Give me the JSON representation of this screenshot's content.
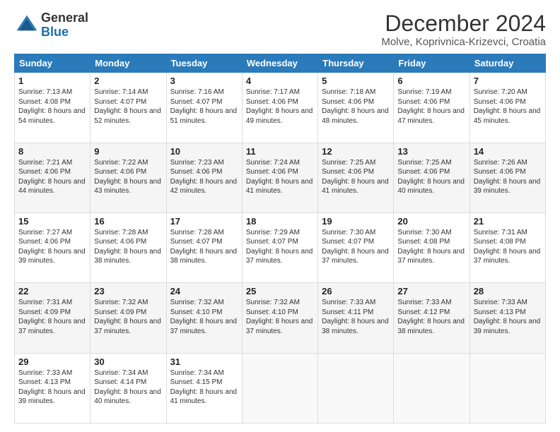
{
  "logo": {
    "general": "General",
    "blue": "Blue"
  },
  "header": {
    "title": "December 2024",
    "subtitle": "Molve, Koprivnica-Krizevci, Croatia"
  },
  "weekdays": [
    "Sunday",
    "Monday",
    "Tuesday",
    "Wednesday",
    "Thursday",
    "Friday",
    "Saturday"
  ],
  "weeks": [
    [
      {
        "day": "1",
        "sunrise": "Sunrise: 7:13 AM",
        "sunset": "Sunset: 4:08 PM",
        "daylight": "Daylight: 8 hours and 54 minutes."
      },
      {
        "day": "2",
        "sunrise": "Sunrise: 7:14 AM",
        "sunset": "Sunset: 4:07 PM",
        "daylight": "Daylight: 8 hours and 52 minutes."
      },
      {
        "day": "3",
        "sunrise": "Sunrise: 7:16 AM",
        "sunset": "Sunset: 4:07 PM",
        "daylight": "Daylight: 8 hours and 51 minutes."
      },
      {
        "day": "4",
        "sunrise": "Sunrise: 7:17 AM",
        "sunset": "Sunset: 4:06 PM",
        "daylight": "Daylight: 8 hours and 49 minutes."
      },
      {
        "day": "5",
        "sunrise": "Sunrise: 7:18 AM",
        "sunset": "Sunset: 4:06 PM",
        "daylight": "Daylight: 8 hours and 48 minutes."
      },
      {
        "day": "6",
        "sunrise": "Sunrise: 7:19 AM",
        "sunset": "Sunset: 4:06 PM",
        "daylight": "Daylight: 8 hours and 47 minutes."
      },
      {
        "day": "7",
        "sunrise": "Sunrise: 7:20 AM",
        "sunset": "Sunset: 4:06 PM",
        "daylight": "Daylight: 8 hours and 45 minutes."
      }
    ],
    [
      {
        "day": "8",
        "sunrise": "Sunrise: 7:21 AM",
        "sunset": "Sunset: 4:06 PM",
        "daylight": "Daylight: 8 hours and 44 minutes."
      },
      {
        "day": "9",
        "sunrise": "Sunrise: 7:22 AM",
        "sunset": "Sunset: 4:06 PM",
        "daylight": "Daylight: 8 hours and 43 minutes."
      },
      {
        "day": "10",
        "sunrise": "Sunrise: 7:23 AM",
        "sunset": "Sunset: 4:06 PM",
        "daylight": "Daylight: 8 hours and 42 minutes."
      },
      {
        "day": "11",
        "sunrise": "Sunrise: 7:24 AM",
        "sunset": "Sunset: 4:06 PM",
        "daylight": "Daylight: 8 hours and 41 minutes."
      },
      {
        "day": "12",
        "sunrise": "Sunrise: 7:25 AM",
        "sunset": "Sunset: 4:06 PM",
        "daylight": "Daylight: 8 hours and 41 minutes."
      },
      {
        "day": "13",
        "sunrise": "Sunrise: 7:25 AM",
        "sunset": "Sunset: 4:06 PM",
        "daylight": "Daylight: 8 hours and 40 minutes."
      },
      {
        "day": "14",
        "sunrise": "Sunrise: 7:26 AM",
        "sunset": "Sunset: 4:06 PM",
        "daylight": "Daylight: 8 hours and 39 minutes."
      }
    ],
    [
      {
        "day": "15",
        "sunrise": "Sunrise: 7:27 AM",
        "sunset": "Sunset: 4:06 PM",
        "daylight": "Daylight: 8 hours and 39 minutes."
      },
      {
        "day": "16",
        "sunrise": "Sunrise: 7:28 AM",
        "sunset": "Sunset: 4:06 PM",
        "daylight": "Daylight: 8 hours and 38 minutes."
      },
      {
        "day": "17",
        "sunrise": "Sunrise: 7:28 AM",
        "sunset": "Sunset: 4:07 PM",
        "daylight": "Daylight: 8 hours and 38 minutes."
      },
      {
        "day": "18",
        "sunrise": "Sunrise: 7:29 AM",
        "sunset": "Sunset: 4:07 PM",
        "daylight": "Daylight: 8 hours and 37 minutes."
      },
      {
        "day": "19",
        "sunrise": "Sunrise: 7:30 AM",
        "sunset": "Sunset: 4:07 PM",
        "daylight": "Daylight: 8 hours and 37 minutes."
      },
      {
        "day": "20",
        "sunrise": "Sunrise: 7:30 AM",
        "sunset": "Sunset: 4:08 PM",
        "daylight": "Daylight: 8 hours and 37 minutes."
      },
      {
        "day": "21",
        "sunrise": "Sunrise: 7:31 AM",
        "sunset": "Sunset: 4:08 PM",
        "daylight": "Daylight: 8 hours and 37 minutes."
      }
    ],
    [
      {
        "day": "22",
        "sunrise": "Sunrise: 7:31 AM",
        "sunset": "Sunset: 4:09 PM",
        "daylight": "Daylight: 8 hours and 37 minutes."
      },
      {
        "day": "23",
        "sunrise": "Sunrise: 7:32 AM",
        "sunset": "Sunset: 4:09 PM",
        "daylight": "Daylight: 8 hours and 37 minutes."
      },
      {
        "day": "24",
        "sunrise": "Sunrise: 7:32 AM",
        "sunset": "Sunset: 4:10 PM",
        "daylight": "Daylight: 8 hours and 37 minutes."
      },
      {
        "day": "25",
        "sunrise": "Sunrise: 7:32 AM",
        "sunset": "Sunset: 4:10 PM",
        "daylight": "Daylight: 8 hours and 37 minutes."
      },
      {
        "day": "26",
        "sunrise": "Sunrise: 7:33 AM",
        "sunset": "Sunset: 4:11 PM",
        "daylight": "Daylight: 8 hours and 38 minutes."
      },
      {
        "day": "27",
        "sunrise": "Sunrise: 7:33 AM",
        "sunset": "Sunset: 4:12 PM",
        "daylight": "Daylight: 8 hours and 38 minutes."
      },
      {
        "day": "28",
        "sunrise": "Sunrise: 7:33 AM",
        "sunset": "Sunset: 4:13 PM",
        "daylight": "Daylight: 8 hours and 39 minutes."
      }
    ],
    [
      {
        "day": "29",
        "sunrise": "Sunrise: 7:33 AM",
        "sunset": "Sunset: 4:13 PM",
        "daylight": "Daylight: 8 hours and 39 minutes."
      },
      {
        "day": "30",
        "sunrise": "Sunrise: 7:34 AM",
        "sunset": "Sunset: 4:14 PM",
        "daylight": "Daylight: 8 hours and 40 minutes."
      },
      {
        "day": "31",
        "sunrise": "Sunrise: 7:34 AM",
        "sunset": "Sunset: 4:15 PM",
        "daylight": "Daylight: 8 hours and 41 minutes."
      },
      null,
      null,
      null,
      null
    ]
  ]
}
